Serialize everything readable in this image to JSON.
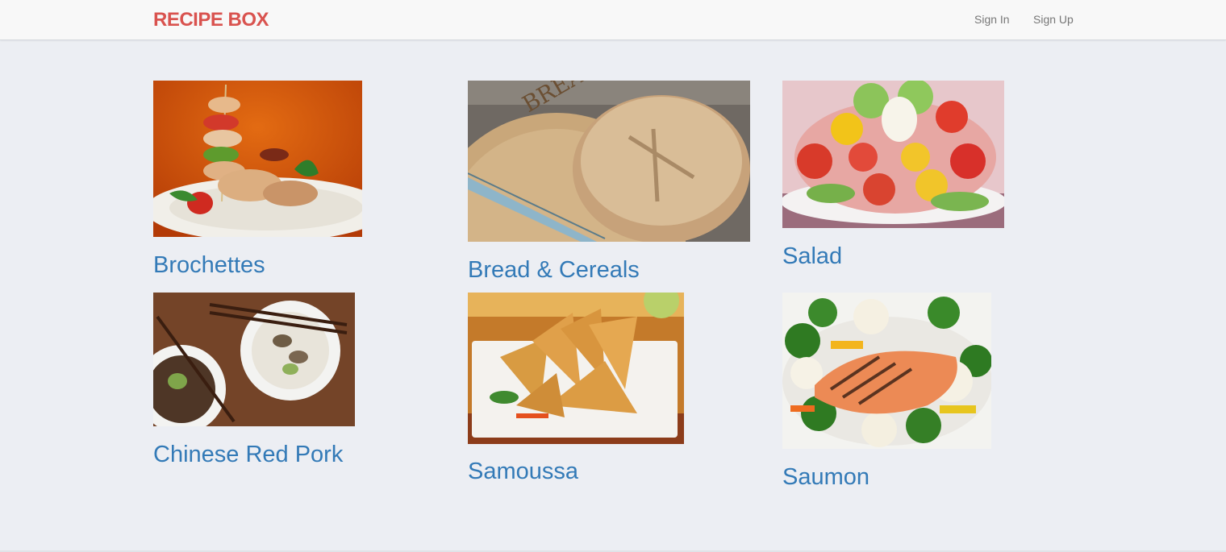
{
  "brand": {
    "label": "RECIPE BOX",
    "color": "#d9534f"
  },
  "nav": {
    "sign_in": "Sign In",
    "sign_up": "Sign Up"
  },
  "link_color": "#337ab7",
  "recipes": [
    {
      "title": "Brochettes",
      "image": "brochettes-photo"
    },
    {
      "title": "Bread & Cereals",
      "image": "bread-photo"
    },
    {
      "title": "Salad",
      "image": "salad-photo"
    },
    {
      "title": "Chinese Red Pork",
      "image": "chinese-red-pork-photo"
    },
    {
      "title": "Samoussa",
      "image": "samoussa-photo"
    },
    {
      "title": "Saumon",
      "image": "saumon-photo"
    }
  ]
}
